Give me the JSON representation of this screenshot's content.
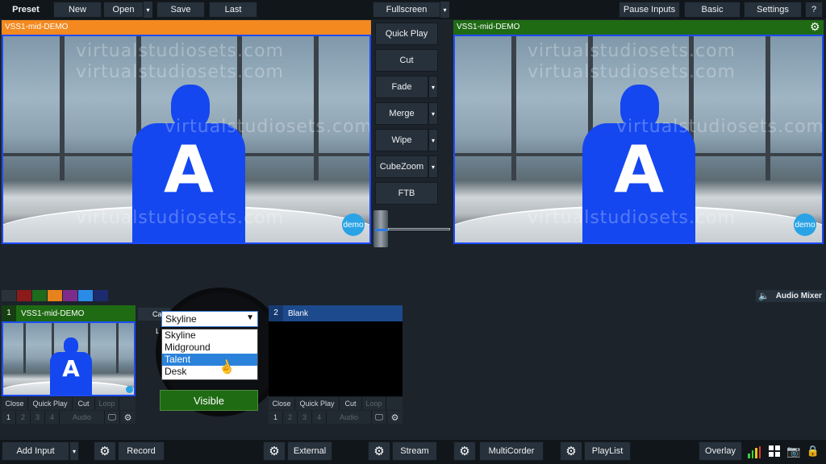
{
  "top": {
    "preset": "Preset",
    "new": "New",
    "open": "Open",
    "save": "Save",
    "last": "Last",
    "fullscreen": "Fullscreen",
    "pause_inputs": "Pause Inputs",
    "basic": "Basic",
    "settings": "Settings",
    "help": "?"
  },
  "preview": {
    "title": "VSS1-mid-DEMO",
    "color": "#f4891f"
  },
  "output": {
    "title": "VSS1-mid-DEMO",
    "color": "#1f6b14"
  },
  "scene": {
    "watermark": "virtualstudiosets.com",
    "letter": "A",
    "demo": "demo"
  },
  "transitions": {
    "quick_play": "Quick Play",
    "cut": "Cut",
    "fade": "Fade",
    "merge": "Merge",
    "wipe": "Wipe",
    "cubezoom": "CubeZoom",
    "ftb": "FTB"
  },
  "swatch_colors": [
    "#8b1a1a",
    "#1e6b1e",
    "#e8821c",
    "#7d2c8c",
    "#2b8ce8",
    "#1c2b6e"
  ],
  "audio_mixer": "Audio Mixer",
  "input1": {
    "num": "1",
    "title": "VSS1-mid-DEMO",
    "color": "#1f6b14",
    "close": "Close",
    "quick_play": "Quick Play",
    "cut": "Cut",
    "loop": "Loop",
    "n1": "1",
    "n2": "2",
    "n3": "3",
    "n4": "4",
    "audio": "Audio"
  },
  "input2": {
    "num": "2",
    "title": "Blank",
    "color": "#1c4a8c",
    "close": "Close",
    "quick_play": "Quick Play",
    "cut": "Cut",
    "loop": "Loop",
    "n1": "1",
    "n2": "2",
    "n3": "3",
    "n4": "4",
    "audio": "Audio"
  },
  "overlay_panel": {
    "camera_label": "Camer",
    "l_label": "L",
    "selected": "Skyline",
    "options": [
      "Skyline",
      "Midground",
      "Talent",
      "Desk"
    ],
    "highlighted": "Talent",
    "visible": "Visible"
  },
  "bottom": {
    "add_input": "Add Input",
    "record": "Record",
    "external": "External",
    "stream": "Stream",
    "multicorder": "MultiCorder",
    "playlist": "PlayList",
    "overlay": "Overlay"
  }
}
